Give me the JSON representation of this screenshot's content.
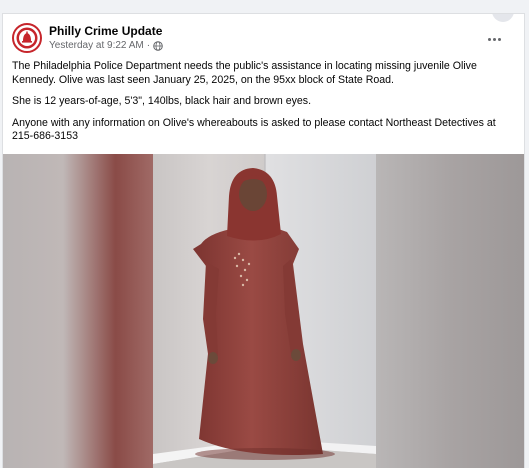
{
  "post": {
    "page_name": "Philly Crime Update",
    "timestamp": "Yesterday at 9:22 AM",
    "separator": "·",
    "audience_icon": "globe-icon",
    "more_icon": "more-options-icon",
    "avatar_icon": "liberty-bell-icon",
    "paragraphs": [
      "The Philadelphia Police Department needs the public's assistance in locating missing juvenile Olive Kennedy. Olive was last seen January 25, 2025, on the 95xx block of State Road.",
      "She is 12 years-of-age, 5'3\", 140lbs, black hair and brown eyes.",
      "Anyone with any information on Olive's whereabouts is asked to please contact Northeast Detectives at 215-686-3153"
    ]
  },
  "colors": {
    "brand_red": "#c6252b",
    "dress": "#8e3f3a",
    "hijab": "#8a3530",
    "wall": "#d7d8da"
  }
}
